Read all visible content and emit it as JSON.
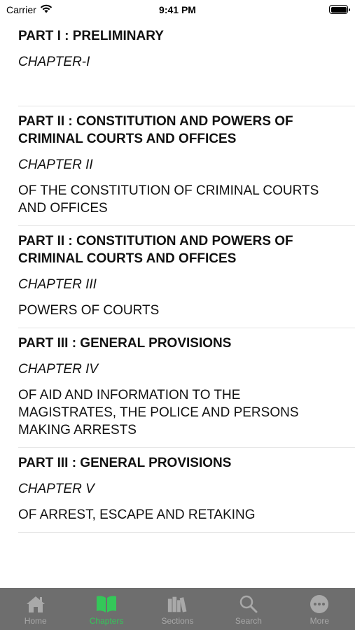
{
  "status_bar": {
    "carrier": "Carrier",
    "time": "9:41 PM"
  },
  "chapters": [
    {
      "part": "PART I : PRELIMINARY",
      "chapter": "CHAPTER-I",
      "description": ""
    },
    {
      "part": "PART II : CONSTITUTION AND POWERS OF CRIMINAL COURTS AND OFFICES",
      "chapter": "CHAPTER II",
      "description": "OF THE CONSTITUTION OF CRIMINAL COURTS AND OFFICES"
    },
    {
      "part": "PART II : CONSTITUTION AND POWERS OF CRIMINAL COURTS AND OFFICES",
      "chapter": "CHAPTER III",
      "description": "POWERS OF COURTS"
    },
    {
      "part": "PART III : GENERAL PROVISIONS",
      "chapter": "CHAPTER IV",
      "description": "OF AID AND INFORMATION TO THE MAGISTRATES, THE POLICE AND PERSONS MAKING ARRESTS"
    },
    {
      "part": "PART III : GENERAL PROVISIONS",
      "chapter": "CHAPTER V",
      "description": "OF ARREST, ESCAPE AND RETAKING"
    }
  ],
  "tab_bar": {
    "active_color": "#34c759",
    "inactive_color": "#a9a9a9",
    "background": "#6e6e6e",
    "tabs": [
      {
        "label": "Home",
        "icon": "home-icon",
        "active": false
      },
      {
        "label": "Chapters",
        "icon": "book-icon",
        "active": true
      },
      {
        "label": "Sections",
        "icon": "books-icon",
        "active": false
      },
      {
        "label": "Search",
        "icon": "search-icon",
        "active": false
      },
      {
        "label": "More",
        "icon": "more-icon",
        "active": false
      }
    ]
  }
}
